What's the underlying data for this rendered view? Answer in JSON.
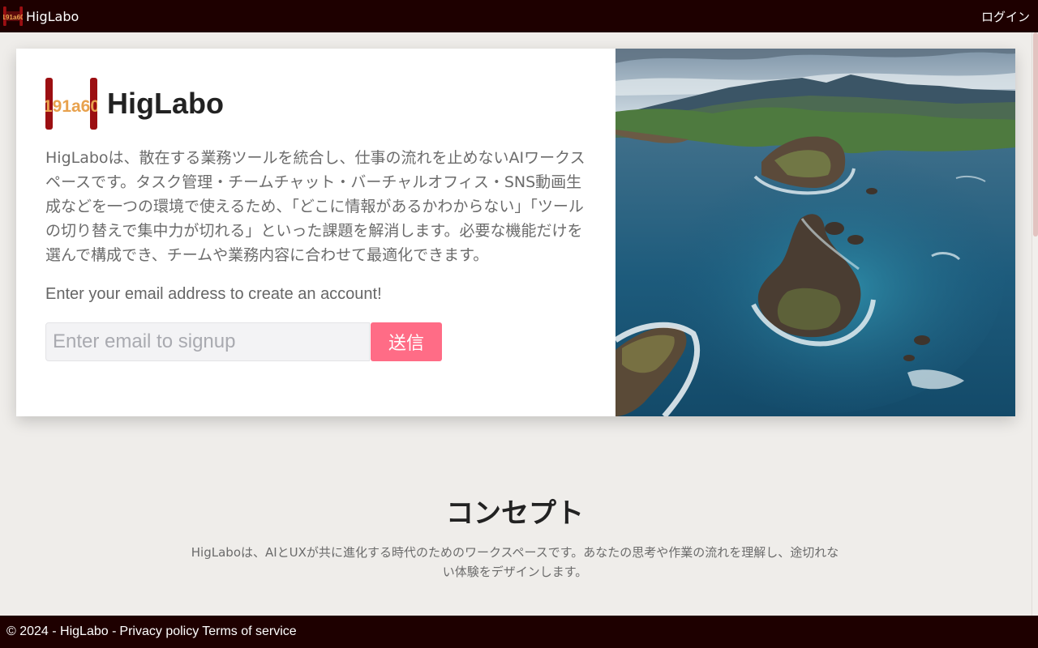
{
  "colors": {
    "bar_bg": "#1e0000",
    "page_bg": "#efedea",
    "accent": "#ff6c86",
    "logo_red": "#9c0f12",
    "logo_gold": "#e8a24e"
  },
  "topbar": {
    "brand": "HigLabo",
    "login": "ログイン",
    "logo_text": "191a60"
  },
  "hero": {
    "title": "HigLabo",
    "logo_text": "191a60",
    "description": "HigLaboは、散在する業務ツールを統合し、仕事の流れを止めないAIワークスペースです。タスク管理・チームチャット・バーチャルオフィス・SNS動画生成などを一つの環境で使えるため、「どこに情報があるかわからない」「ツールの切り替えで集中力が切れる」といった課題を解消します。必要な機能だけを選んで構成でき、チームや業務内容に合わせて最適化できます。",
    "cta": "Enter your email address to create an account!",
    "email_placeholder": "Enter email to signup",
    "email_value": "",
    "submit_label": "送信",
    "image_alt": "aerial-coastline-photo"
  },
  "concept": {
    "title": "コンセプト",
    "body": "HigLaboは、AIとUXが共に進化する時代のためのワークスペースです。あなたの思考や作業の流れを理解し、途切れない体験をデザインします。"
  },
  "footer": {
    "copyright": "© 2024 - HigLabo -",
    "privacy": "Privacy policy",
    "terms": "Terms of service"
  }
}
